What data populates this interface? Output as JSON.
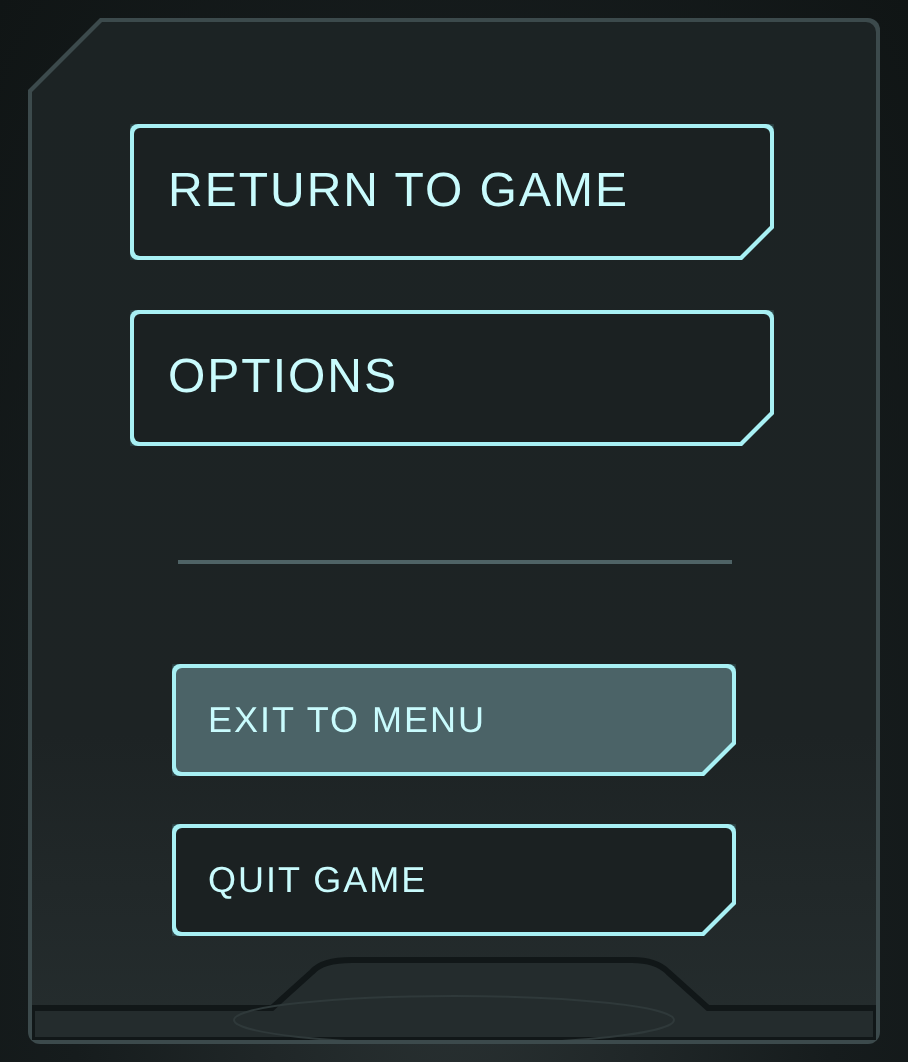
{
  "menu": [
    {
      "kind": "large",
      "label": "RETURN TO GAME",
      "selected": false
    },
    {
      "kind": "large",
      "label": "OPTIONS",
      "selected": false
    },
    {
      "kind": "divider"
    },
    {
      "kind": "small",
      "label": "EXIT TO MENU",
      "selected": true
    },
    {
      "kind": "small",
      "label": "QUIT GAME",
      "selected": false
    }
  ]
}
